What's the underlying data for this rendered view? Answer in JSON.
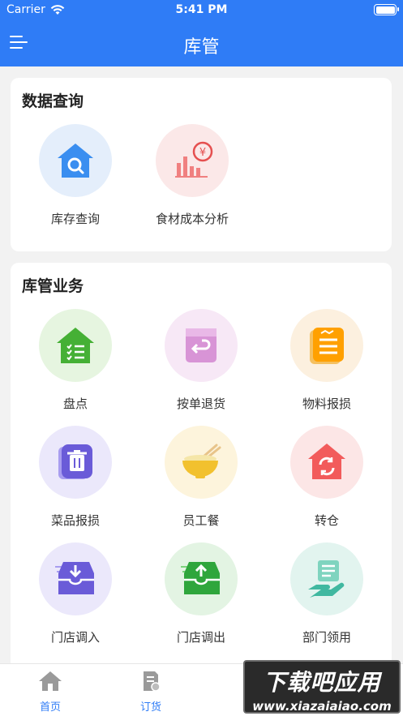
{
  "status_bar": {
    "carrier": "Carrier",
    "time": "5:41 PM"
  },
  "nav": {
    "title": "库管"
  },
  "data_query": {
    "title": "数据查询",
    "items": [
      {
        "label": "库存查询",
        "icon": "house-search-icon"
      },
      {
        "label": "食材成本分析",
        "icon": "cost-chart-icon"
      }
    ]
  },
  "warehouse": {
    "title": "库管业务",
    "items": [
      {
        "label": "盘点",
        "icon": "inventory-check-icon"
      },
      {
        "label": "按单退货",
        "icon": "return-box-icon"
      },
      {
        "label": "物料报损",
        "icon": "material-loss-icon"
      },
      {
        "label": "菜品报损",
        "icon": "trash-icon"
      },
      {
        "label": "员工餐",
        "icon": "noodle-bowl-icon"
      },
      {
        "label": "转仓",
        "icon": "warehouse-transfer-icon"
      },
      {
        "label": "门店调入",
        "icon": "transfer-in-icon"
      },
      {
        "label": "门店调出",
        "icon": "transfer-out-icon"
      },
      {
        "label": "部门领用",
        "icon": "hand-document-icon"
      }
    ]
  },
  "tabbar": {
    "tabs": [
      {
        "label": "首页",
        "icon": "home-icon"
      },
      {
        "label": "订货",
        "icon": "order-doc-icon"
      }
    ]
  },
  "watermark": {
    "line1": "下载吧应用",
    "line2": "www.xiazaiaiao.com"
  },
  "colors": {
    "primary": "#2f7cf6",
    "green": "#3cb43c",
    "orange": "#ffa000",
    "purple": "#6a5bd8",
    "red": "#f25b5b",
    "pink": "#d88fd6",
    "teal": "#40b8a0"
  }
}
